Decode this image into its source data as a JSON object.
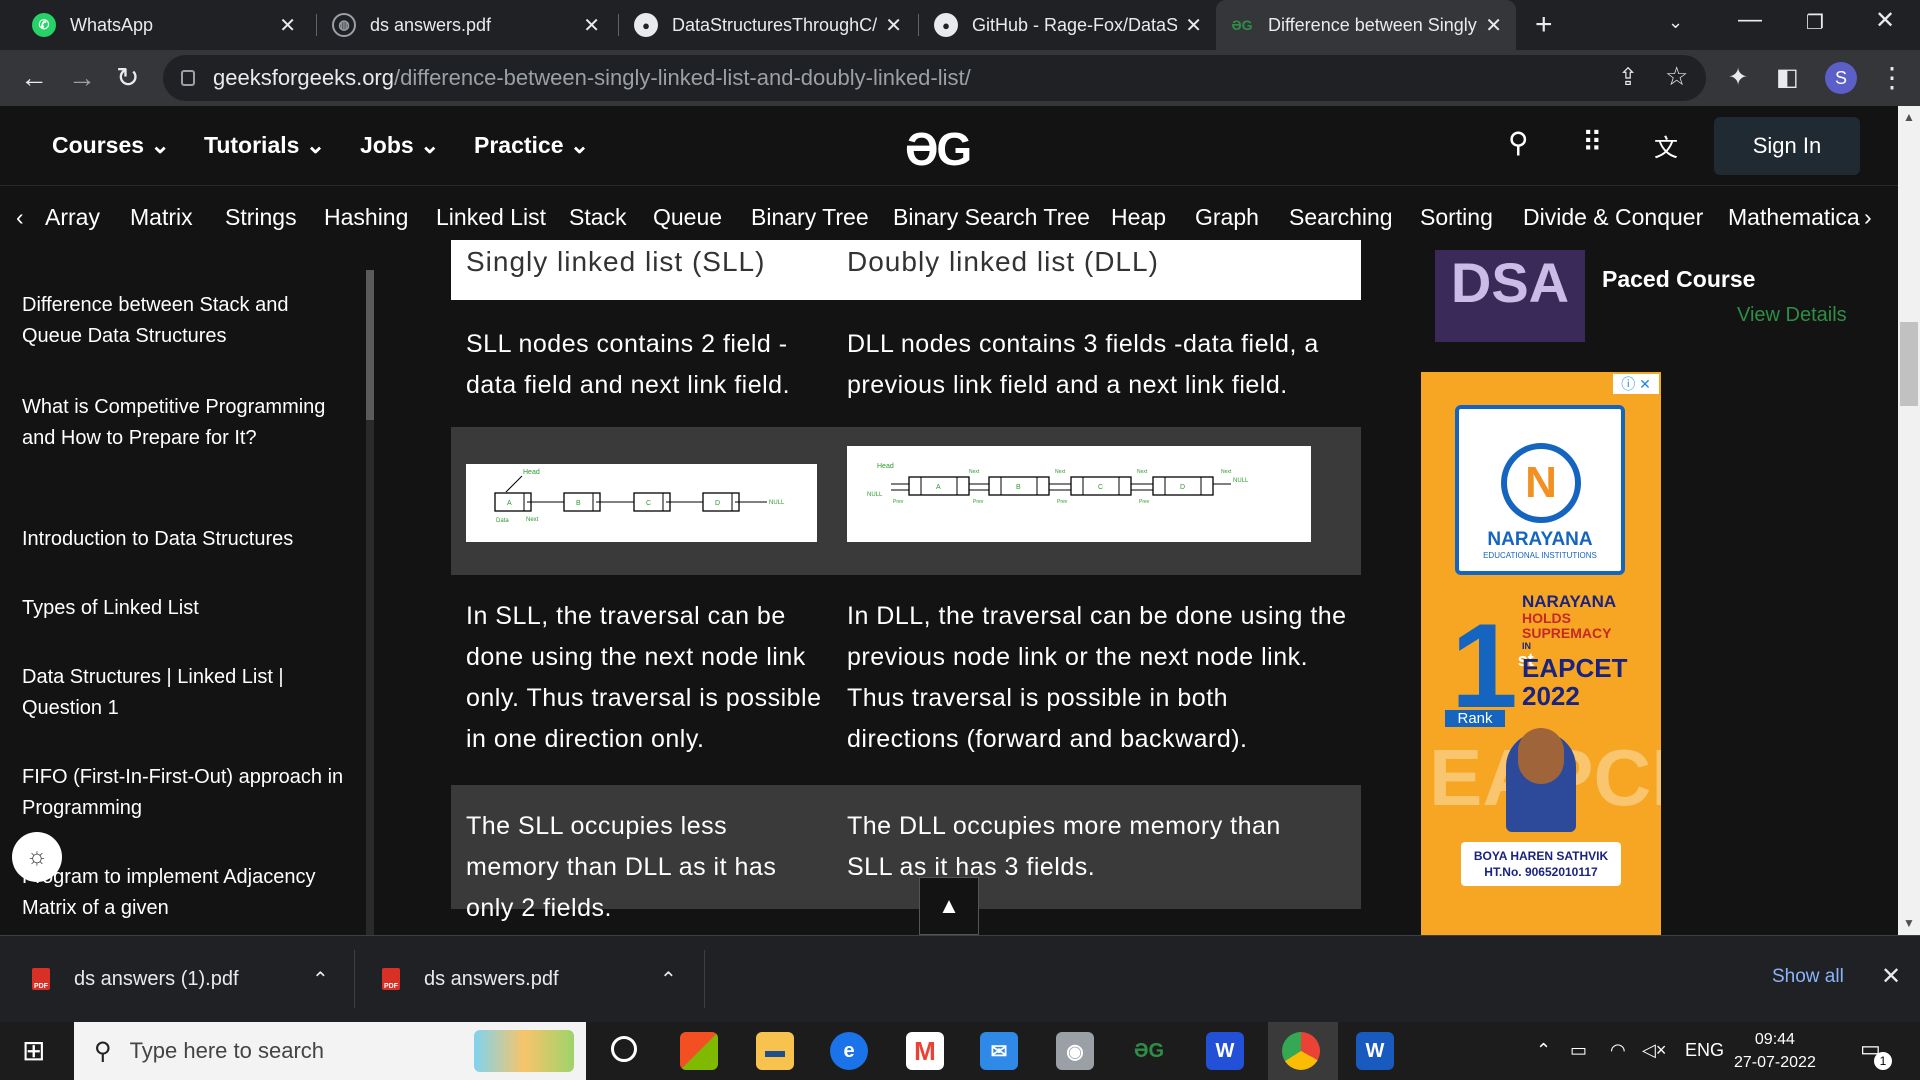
{
  "tabs": [
    {
      "title": "WhatsApp",
      "icon": "whatsapp-icon"
    },
    {
      "title": "ds answers.pdf",
      "icon": "globe-icon"
    },
    {
      "title": "DataStructuresThroughC/",
      "icon": "github-icon"
    },
    {
      "title": "GitHub - Rage-Fox/DataS",
      "icon": "github-icon"
    },
    {
      "title": "Difference between Singly",
      "icon": "gfg-icon"
    }
  ],
  "address": {
    "host": "geeksforgeeks.org",
    "path": "/difference-between-singly-linked-list-and-doubly-linked-list/"
  },
  "profile_initial": "S",
  "header": {
    "menus": [
      "Courses",
      "Tutorials",
      "Jobs",
      "Practice"
    ],
    "sign_in": "Sign In"
  },
  "topics": [
    "Array",
    "Matrix",
    "Strings",
    "Hashing",
    "Linked List",
    "Stack",
    "Queue",
    "Binary Tree",
    "Binary Search Tree",
    "Heap",
    "Graph",
    "Searching",
    "Sorting",
    "Divide & Conquer",
    "Mathematica"
  ],
  "sidebar": {
    "items": [
      "Difference between Stack and Queue Data Structures",
      "What is Competitive Programming and How to Prepare for It?",
      "Introduction to Data Structures",
      "Types of Linked List",
      "Data Structures | Linked List | Question 1",
      "FIFO (First-In-First-Out) approach in Programming",
      "Program to implement Adjacency Matrix of a given"
    ]
  },
  "table": {
    "headers": [
      "Singly linked list (SLL)",
      "Doubly linked list (DLL)"
    ],
    "rows": [
      [
        "SLL nodes contains 2 field -data field and next link field.",
        "DLL nodes contains 3 fields -data field, a previous link field and a next link field."
      ],
      [
        "In SLL, the traversal can be done using the next node link only. Thus traversal is possible in one direction only.",
        "In DLL, the traversal can be done using the previous node link or the next node link. Thus traversal is possible in both directions (forward and backward)."
      ],
      [
        "The SLL occupies less memory than DLL as it has only 2 fields.",
        "The DLL occupies more memory than SLL as it has 3 fields."
      ]
    ],
    "sll_diagram": {
      "head": "Head",
      "nodes": [
        "A",
        "B",
        "C",
        "D"
      ],
      "data": "Data",
      "next": "Next",
      "null": "NULL"
    },
    "dll_diagram": {
      "head": "Head",
      "nodes": [
        "A",
        "B",
        "C",
        "D"
      ],
      "next": "Next",
      "prev": "Prev",
      "null": "NULL"
    }
  },
  "course": {
    "title": "Paced Course",
    "link": "View Details",
    "badge": "DSA"
  },
  "ad": {
    "brand": "NARAYANA",
    "sub": "EDUCATIONAL INSTITUTIONS",
    "rank_num": "1",
    "rank_sup": "st",
    "rank": "Rank",
    "l1": "NARAYANA",
    "l2": "HOLDS",
    "l3": "SUPREMACY",
    "l4": "IN",
    "exam": "EAPCET",
    "year": "2022",
    "bg": "EAPCET",
    "student": "BOYA HAREN SATHVIK",
    "htno": "HT.No. 90652010117"
  },
  "downloads": [
    {
      "name": "ds answers (1).pdf"
    },
    {
      "name": "ds answers.pdf"
    }
  ],
  "show_all": "Show all",
  "taskbar": {
    "search_placeholder": "Type here to search",
    "lang": "ENG",
    "time": "09:44",
    "date": "27-07-2022",
    "notif_count": "1"
  }
}
